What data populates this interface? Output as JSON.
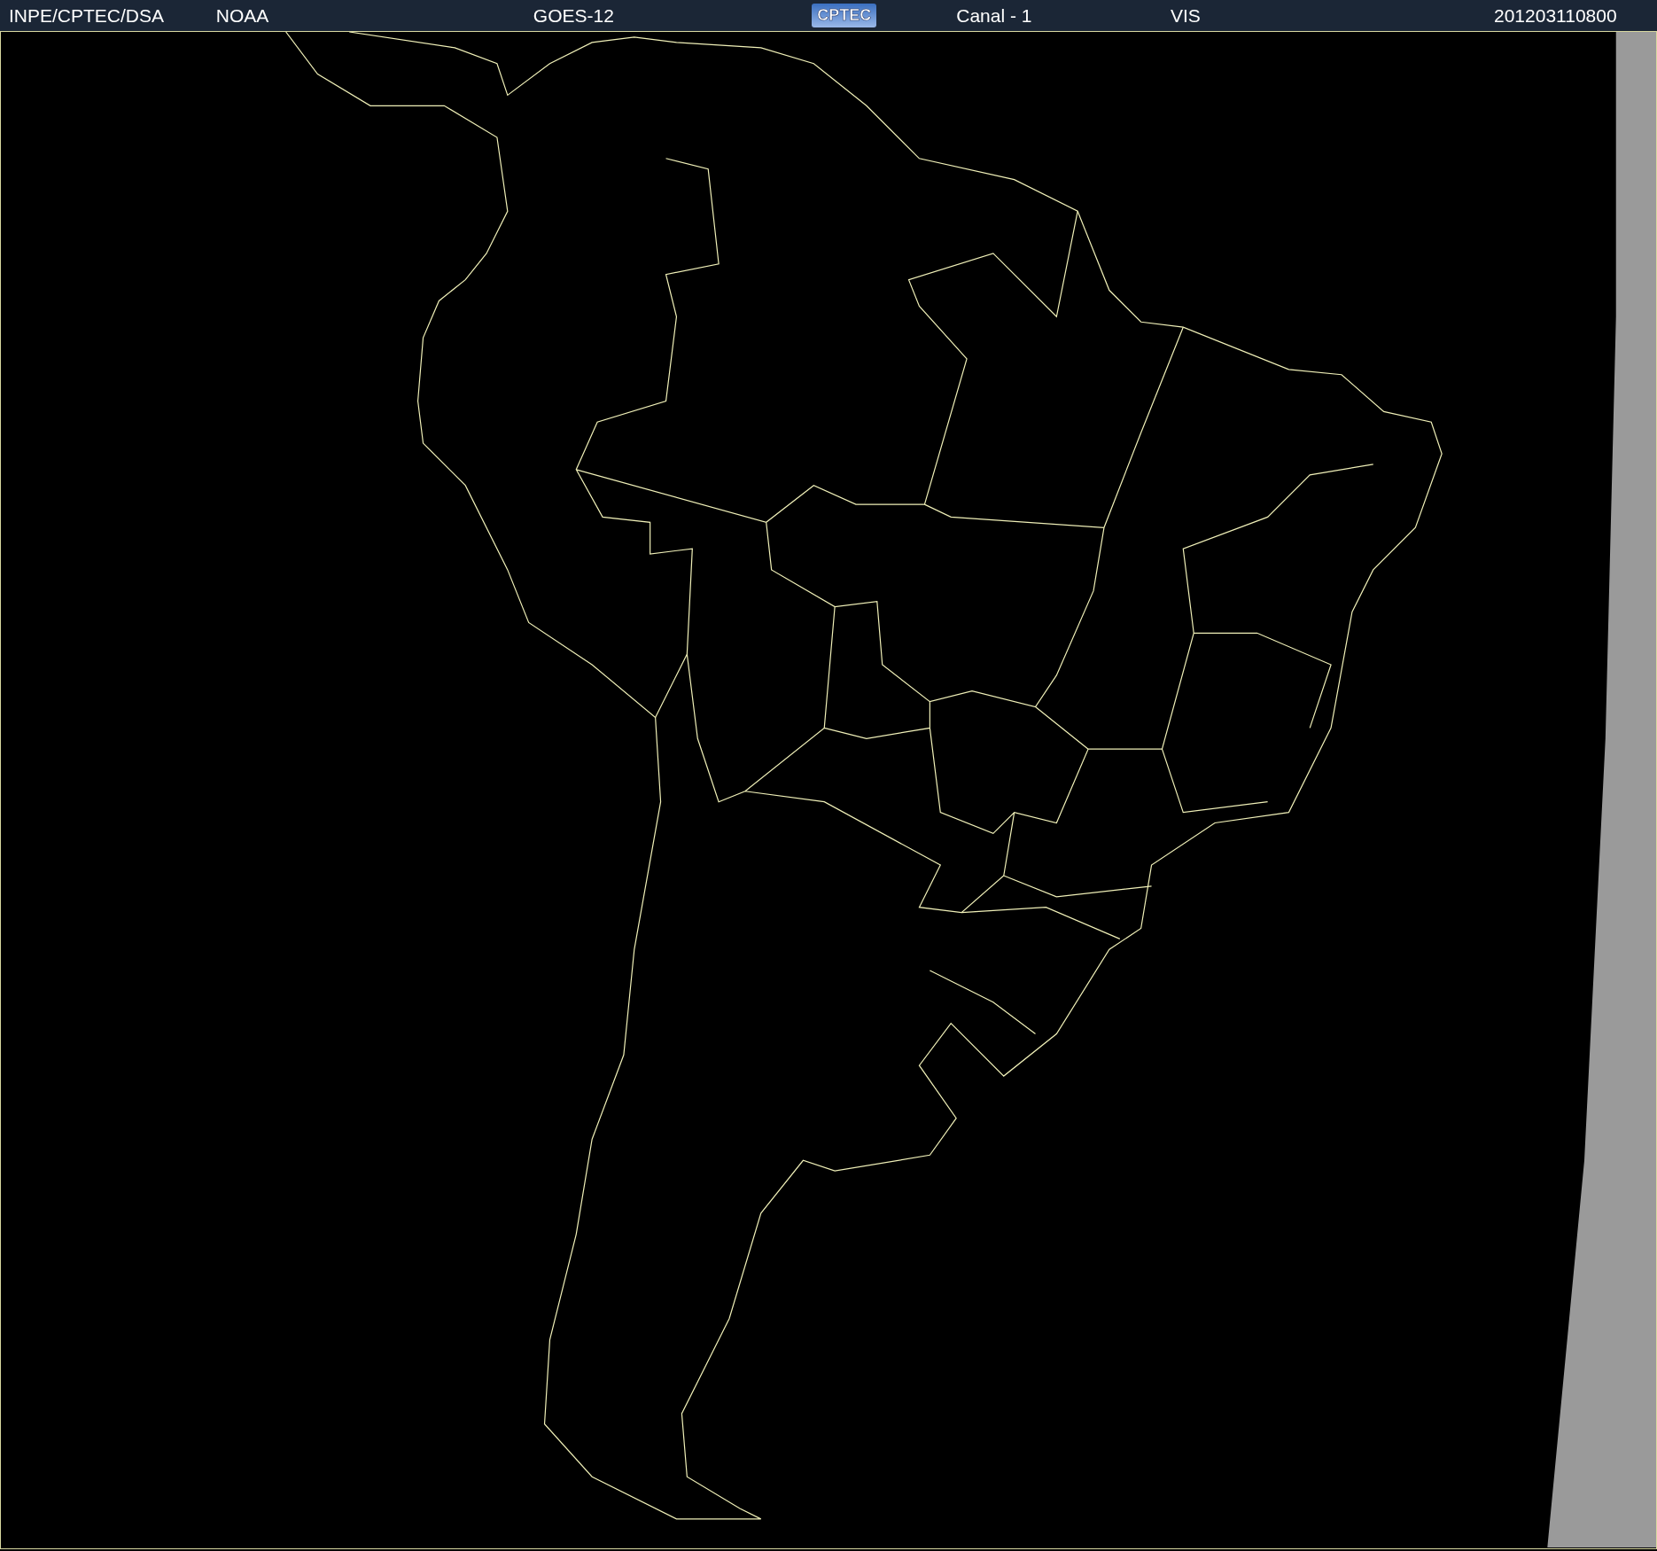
{
  "header": {
    "items": [
      {
        "kind": "text",
        "text": "INPE/CPTEC/DSA"
      },
      {
        "kind": "text",
        "text": "NOAA"
      },
      {
        "kind": "text",
        "text": "GOES-12"
      },
      {
        "kind": "logo",
        "text": "CPTEC"
      },
      {
        "kind": "text",
        "text": "Canal - 1"
      },
      {
        "kind": "text",
        "text": "VIS"
      },
      {
        "kind": "text",
        "text": "201203110800"
      }
    ]
  }
}
